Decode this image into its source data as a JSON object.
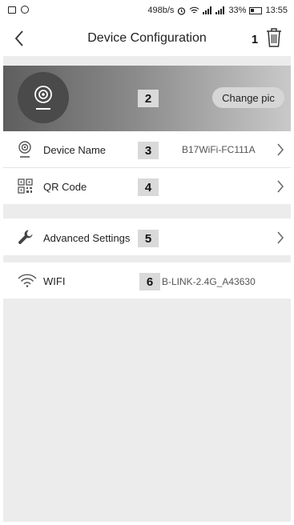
{
  "status_bar": {
    "speed": "498b/s",
    "battery": "33%",
    "time": "13:55"
  },
  "header": {
    "title": "Device Configuration",
    "delete_icon": "trash-icon"
  },
  "banner": {
    "change_pic_label": "Change pic"
  },
  "callouts": [
    "1",
    "2",
    "3",
    "4",
    "5",
    "6"
  ],
  "rows": {
    "device_name": {
      "label": "Device Name",
      "value": "B17WiFi-FC111A"
    },
    "qr_code": {
      "label": "QR Code"
    },
    "advanced": {
      "label": "Advanced Settings"
    },
    "wifi": {
      "label": "WIFI",
      "value": "B-LINK-2.4G_A43630"
    }
  },
  "colors": {
    "background": "#ececec",
    "banner_dark": "#5e5e5e",
    "banner_light": "#c9c9c9",
    "callout_bg": "#d9d9d9"
  }
}
